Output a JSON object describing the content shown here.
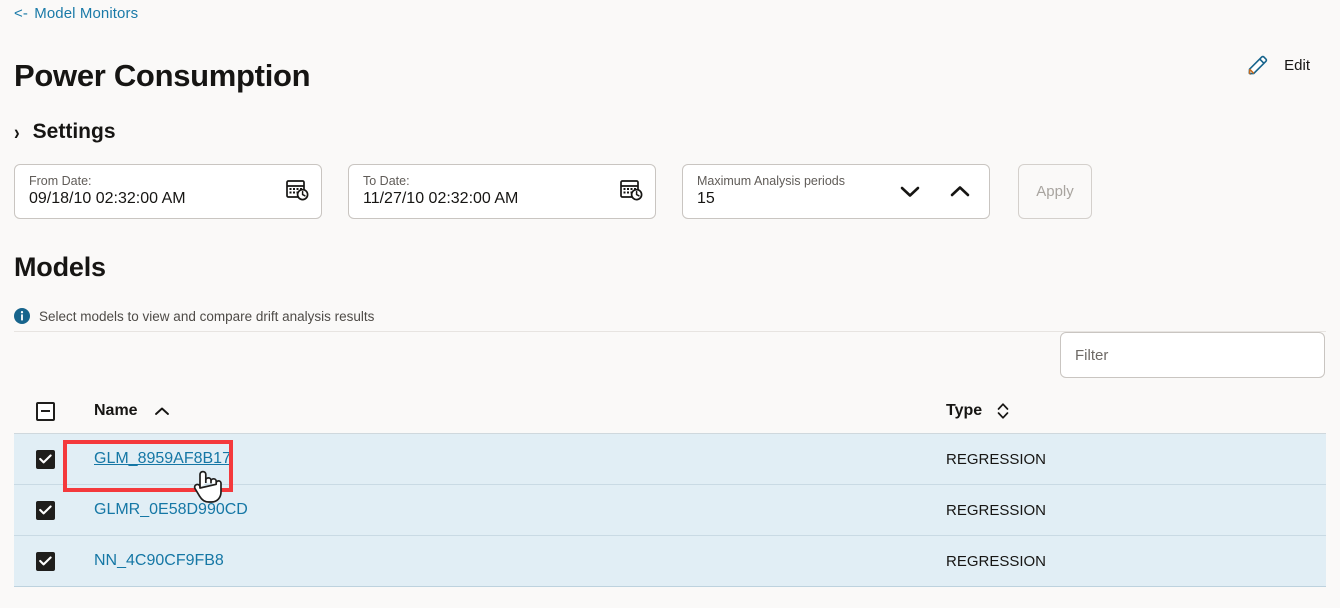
{
  "breadcrumb": {
    "arrow": "<-",
    "label": "Model Monitors",
    "name": "back-to-model-monitors-link"
  },
  "header": {
    "title": "Power Consumption",
    "edit_label": "Edit",
    "edit_icon": "pencil-icon"
  },
  "settings": {
    "section_title": "Settings",
    "chevron": "›",
    "from_date": {
      "label": "From Date:",
      "value": "09/18/10 02:32:00 AM",
      "icon": "calendar-clock-icon"
    },
    "to_date": {
      "label": "To Date:",
      "value": "11/27/10 02:32:00 AM",
      "icon": "calendar-clock-icon"
    },
    "max_periods": {
      "label": "Maximum Analysis periods",
      "value": "15",
      "down_icon": "chevron-down-icon",
      "up_icon": "chevron-up-icon"
    },
    "apply_label": "Apply",
    "apply_disabled": true
  },
  "models": {
    "title": "Models",
    "hint": "Select models to view and compare drift analysis results",
    "hint_icon": "info-icon",
    "filter_placeholder": "Filter",
    "filter_value": "",
    "table": {
      "header_checkbox_state": "indeterminate",
      "columns": [
        {
          "key": "name",
          "label": "Name",
          "sort": "asc",
          "sort_icon": "chevron-up-icon"
        },
        {
          "key": "type",
          "label": "Type",
          "sort": "none",
          "sort_icon": "sort-updown-icon"
        }
      ],
      "rows": [
        {
          "checked": true,
          "name": "GLM_8959AF8B17",
          "type": "REGRESSION",
          "highlighted": true
        },
        {
          "checked": true,
          "name": "GLMR_0E58D990CD",
          "type": "REGRESSION",
          "highlighted": false
        },
        {
          "checked": true,
          "name": "NN_4C90CF9FB8",
          "type": "REGRESSION",
          "highlighted": false
        }
      ]
    }
  },
  "annotation": {
    "target": "GLM_8959AF8B17",
    "box_color": "#f4393c",
    "cursor": "hand-pointer-cursor"
  },
  "colors": {
    "page_background": "#faf9f8",
    "link": "#1577a5",
    "row_selected_background": "#e1eef5",
    "text": "#161513",
    "muted_text": "#605c58",
    "info_icon": "#17648c",
    "annotation_red": "#f4393c"
  }
}
